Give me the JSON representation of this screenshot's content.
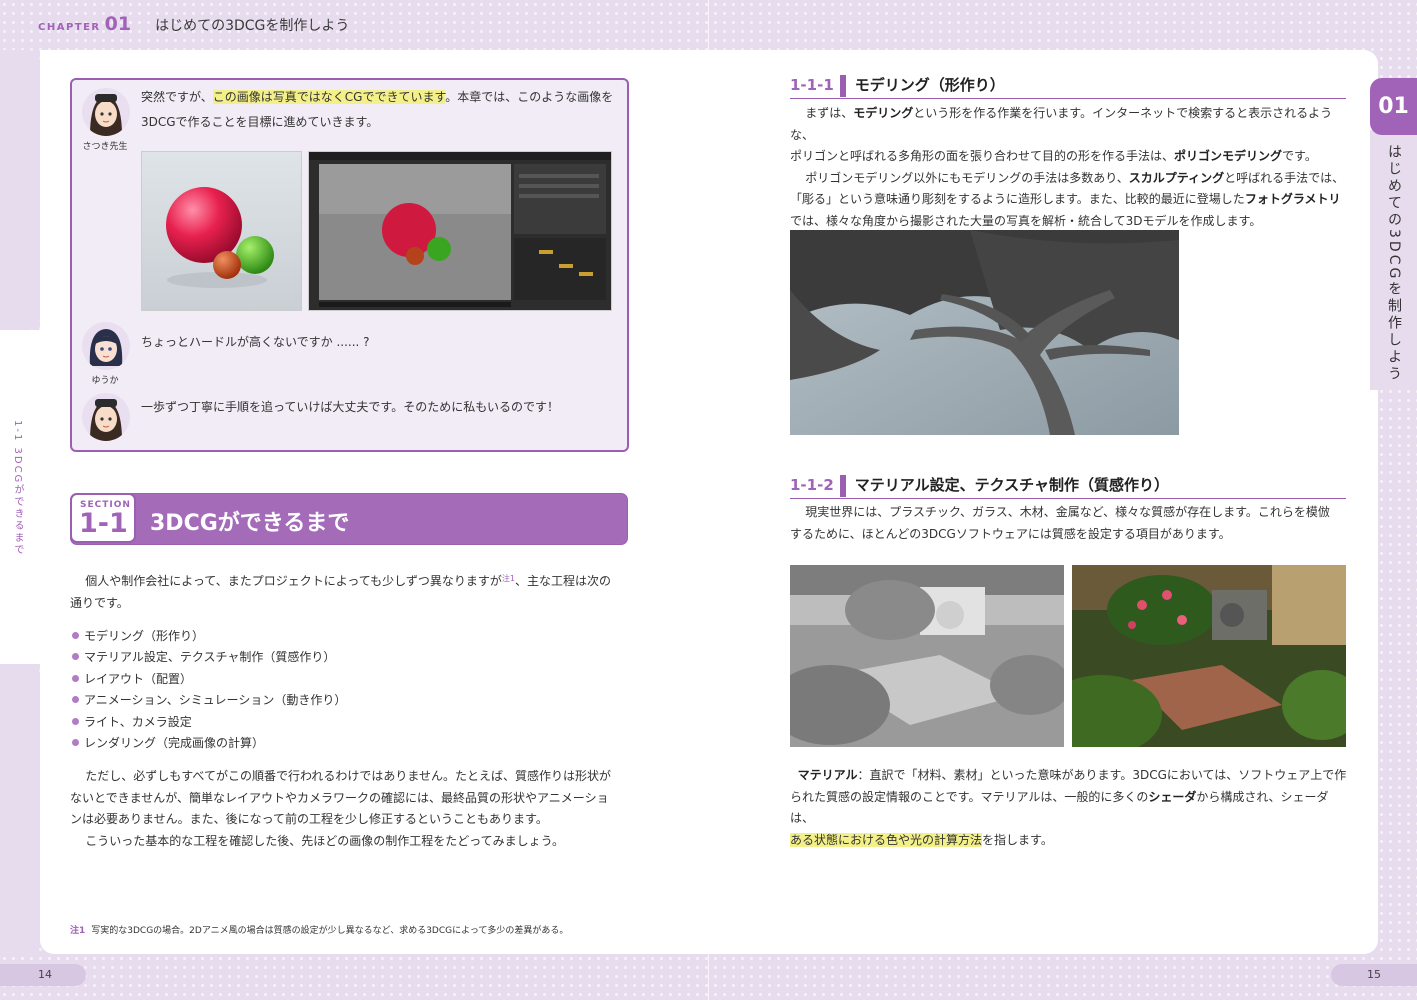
{
  "header": {
    "chapter_word": "CHAPTER",
    "chapter_num": "01",
    "chapter_title": "はじめての3DCGを制作しよう"
  },
  "dialog": {
    "line1_pre": "突然ですが、",
    "line1_hl": "この画像は写真ではなくCGでできています",
    "line1_post": "。本章では、このような画像を",
    "line1b": "3DCGで作ることを目標に進めていきます。",
    "speaker1": "さつき先生",
    "speaker2": "ゆうか",
    "line2": "ちょっとハードルが高くないですか ...... ?",
    "line3": "一歩ずつ丁寧に手順を追っていけば大丈夫です。そのために私もいるのです！"
  },
  "section": {
    "label": "SECTION",
    "number": "1-1",
    "title": "3DCGができるまで"
  },
  "intro": {
    "p1a": "個人や制作会社によって、またプロジェクトによっても少しずつ異なりますが",
    "p1_note": "注1",
    "p1b": "、主な工程は次の",
    "p1c": "通りです。"
  },
  "bullets": [
    "モデリング（形作り）",
    "マテリアル設定、テクスチャ制作（質感作り）",
    "レイアウト（配置）",
    "アニメーション、シミュレーション（動き作り）",
    "ライト、カメラ設定",
    "レンダリング（完成画像の計算）"
  ],
  "para2": [
    "ただし、必ずしもすべてがこの順番で行われるわけではありません。たとえば、質感作りは形状が",
    "ないとできませんが、簡単なレイアウトやカメラワークの確認には、最終品質の形状やアニメーショ",
    "ンは必要ありません。また、後になって前の工程を少し修正するということもあります。",
    "こういった基本的な工程を確認した後、先ほどの画像の制作工程をたどってみましょう。"
  ],
  "footnote": {
    "label": "注1",
    "text": "写実的な3DCGの場合。2Dアニメ風の場合は質感の設定が少し異なるなど、求める3DCGによって多少の差異がある。"
  },
  "left_side_vertical": "1-1 3DCGができるまで",
  "page_left": "14",
  "page_right": "15",
  "chapter_tab": {
    "num": "01",
    "vertical": "はじめての3DCGを制作しよう"
  },
  "sub1": {
    "num": "1-1-1",
    "title": "モデリング（形作り）",
    "l1a": "まずは、",
    "l1b": "モデリング",
    "l1c": "という形を作る作業を行います。インターネットで検索すると表示されるような、",
    "l2a": "ポリゴンと呼ばれる多角形の面を張り合わせて目的の形を作る手法は、",
    "l2b": "ポリゴンモデリング",
    "l2c": "です。",
    "l3a": "ポリゴンモデリング以外にもモデリングの手法は多数あり、",
    "l3b": "スカルプティング",
    "l3c": "と呼ばれる手法では、",
    "l4a": "「彫る」という意味通り彫刻をするように造形します。また、比較的最近に登場した",
    "l4b": "フォトグラメトリ",
    "l5": "では、様々な角度から撮影された大量の写真を解析・統合して3Dモデルを作成します。"
  },
  "sub2": {
    "num": "1-1-2",
    "title": "マテリアル設定、テクスチャ制作（質感作り）",
    "l1": "現実世界には、プラスチック、ガラス、木材、金属など、様々な質感が存在します。これらを模倣",
    "l2": "するために、ほとんどの3DCGソフトウェアには質感を設定する項目があります。"
  },
  "material": {
    "l1a": "マテリアル",
    "l1b": "：直訳で「材料、素材」といった意味があります。3DCGにおいては、ソフトウェア上で作",
    "l2a": "られた質感の設定情報のことです。マテリアルは、一般的に多くの",
    "l2b": "シェーダ",
    "l2c": "から構成され、シェーダは、",
    "l3a": "ある状態における色や光の計算方法",
    "l3b": "を指します。"
  },
  "colors": {
    "accent": "#a163b8",
    "section_bg": "#a46bb9",
    "highlight": "#f3f08a",
    "page_bg": "#e6dced"
  }
}
